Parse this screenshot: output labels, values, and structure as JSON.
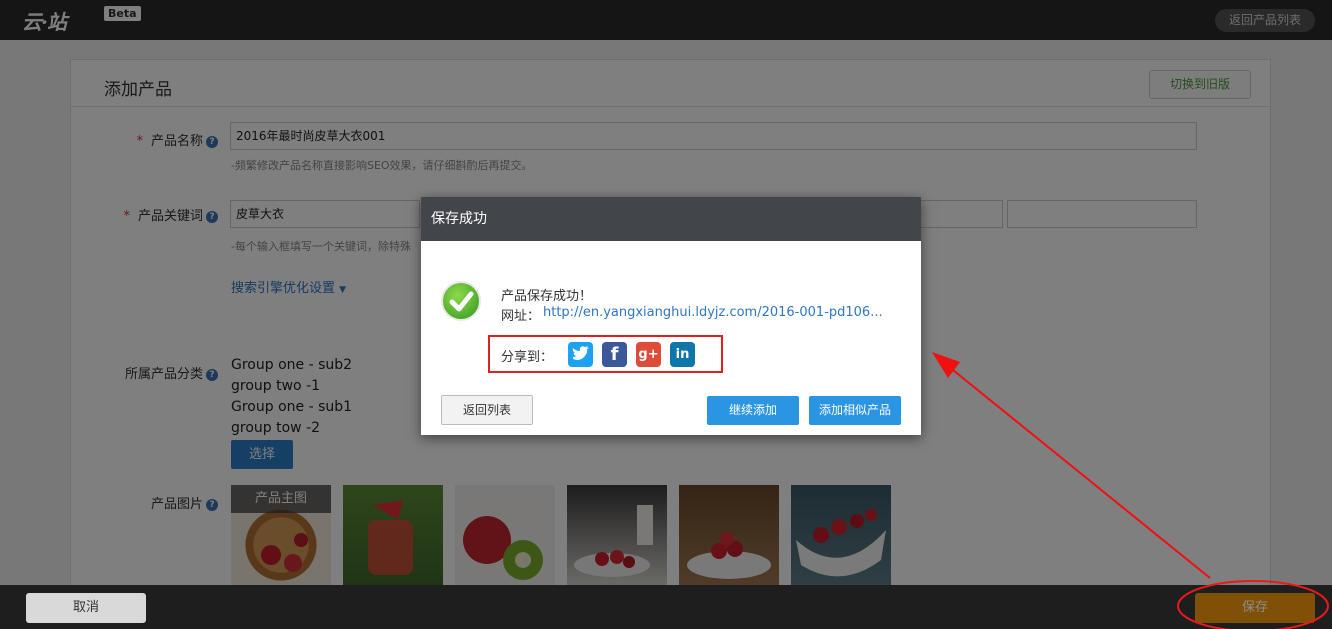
{
  "topbar": {
    "logo_text": "云·站",
    "beta_label": "Beta",
    "back_to_list": "返回产品列表"
  },
  "page": {
    "title": "添加产品",
    "switch_old": "切换到旧版"
  },
  "form": {
    "name_label": "产品名称",
    "name_value": "2016年最时尚皮草大衣001",
    "name_hint": "-频繁修改产品名称直接影响SEO效果，请仔细斟酌后再提交。",
    "keyword_label": "产品关键词",
    "keyword_value": "皮草大衣",
    "keyword_hint": "-每个输入框填写一个关键词，除特殊",
    "seo_link": "搜索引擎优化设置",
    "category_label": "所属产品分类",
    "categories": [
      "Group one - sub2",
      "group two -1",
      "Group one - sub1",
      "group tow -2"
    ],
    "select_button": "选择",
    "images_label": "产品图片",
    "main_image_tag": "产品主图"
  },
  "bottombar": {
    "cancel": "取消",
    "save": "保存"
  },
  "dialog": {
    "title": "保存成功",
    "message": "产品保存成功！",
    "url_label": "网址：",
    "url": "http://en.yangxianghui.ldyjz.com/2016-001-pd106...",
    "share_label": "分享到：",
    "share_icons": [
      "twitter-icon",
      "facebook-icon",
      "google-plus-icon",
      "linkedin-icon"
    ],
    "back_to_list": "返回列表",
    "continue_add": "继续添加",
    "add_similar": "添加相似产品"
  },
  "colors": {
    "accent_blue": "#2a95e2",
    "save_orange": "#e8920a",
    "annotation_red": "#e02020"
  }
}
